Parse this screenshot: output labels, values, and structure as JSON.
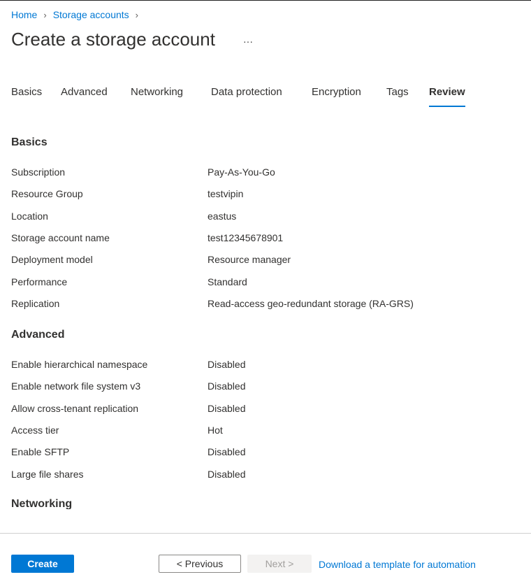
{
  "breadcrumb": [
    "Home",
    "Storage accounts"
  ],
  "title": "Create a storage account",
  "more_label": "···",
  "tabs": [
    {
      "label": "Basics",
      "active": false
    },
    {
      "label": "Advanced",
      "active": false
    },
    {
      "label": "Networking",
      "active": false
    },
    {
      "label": "Data protection",
      "active": false
    },
    {
      "label": "Encryption",
      "active": false
    },
    {
      "label": "Tags",
      "active": false
    },
    {
      "label": "Review",
      "active": true
    }
  ],
  "sections": [
    {
      "title": "Basics",
      "rows": [
        [
          "Subscription",
          "Pay-As-You-Go"
        ],
        [
          "Resource Group",
          "testvipin"
        ],
        [
          "Location",
          "eastus"
        ],
        [
          "Storage account name",
          "test12345678901"
        ],
        [
          "Deployment model",
          "Resource manager"
        ],
        [
          "Performance",
          "Standard"
        ],
        [
          "Replication",
          "Read-access geo-redundant storage (RA-GRS)"
        ]
      ]
    },
    {
      "title": "Advanced",
      "rows": [
        [
          "Enable hierarchical namespace",
          "Disabled"
        ],
        [
          "Enable network file system v3",
          "Disabled"
        ],
        [
          "Allow cross-tenant replication",
          "Disabled"
        ],
        [
          "Access tier",
          "Hot"
        ],
        [
          "Enable SFTP",
          "Disabled"
        ],
        [
          "Large file shares",
          "Disabled"
        ]
      ]
    },
    {
      "title": "Networking",
      "rows": []
    }
  ],
  "footer": {
    "create": "Create",
    "previous": "< Previous",
    "next": "Next >",
    "download": "Download a template for automation"
  },
  "colors": {
    "accent": "#0078d4"
  }
}
